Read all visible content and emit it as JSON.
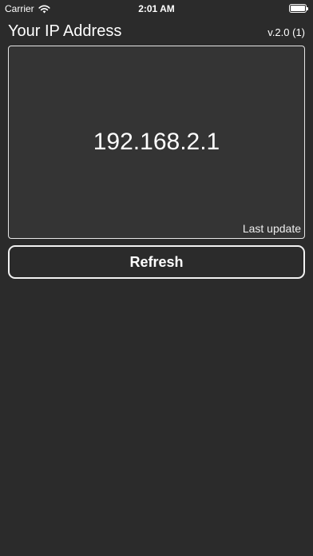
{
  "status_bar": {
    "carrier": "Carrier",
    "time": "2:01 AM",
    "wifi_icon": "wifi-icon",
    "battery_icon": "battery-icon",
    "battery_level": 1.0
  },
  "header": {
    "title": "Your IP Address",
    "version": "v.2.0 (1)"
  },
  "ip_panel": {
    "ip_address": "192.168.2.1",
    "last_update_label": "Last update"
  },
  "actions": {
    "refresh_label": "Refresh"
  },
  "colors": {
    "background": "#2b2b2b",
    "panel_background": "#343434",
    "text": "#ffffff",
    "border": "#e6e6e6"
  }
}
